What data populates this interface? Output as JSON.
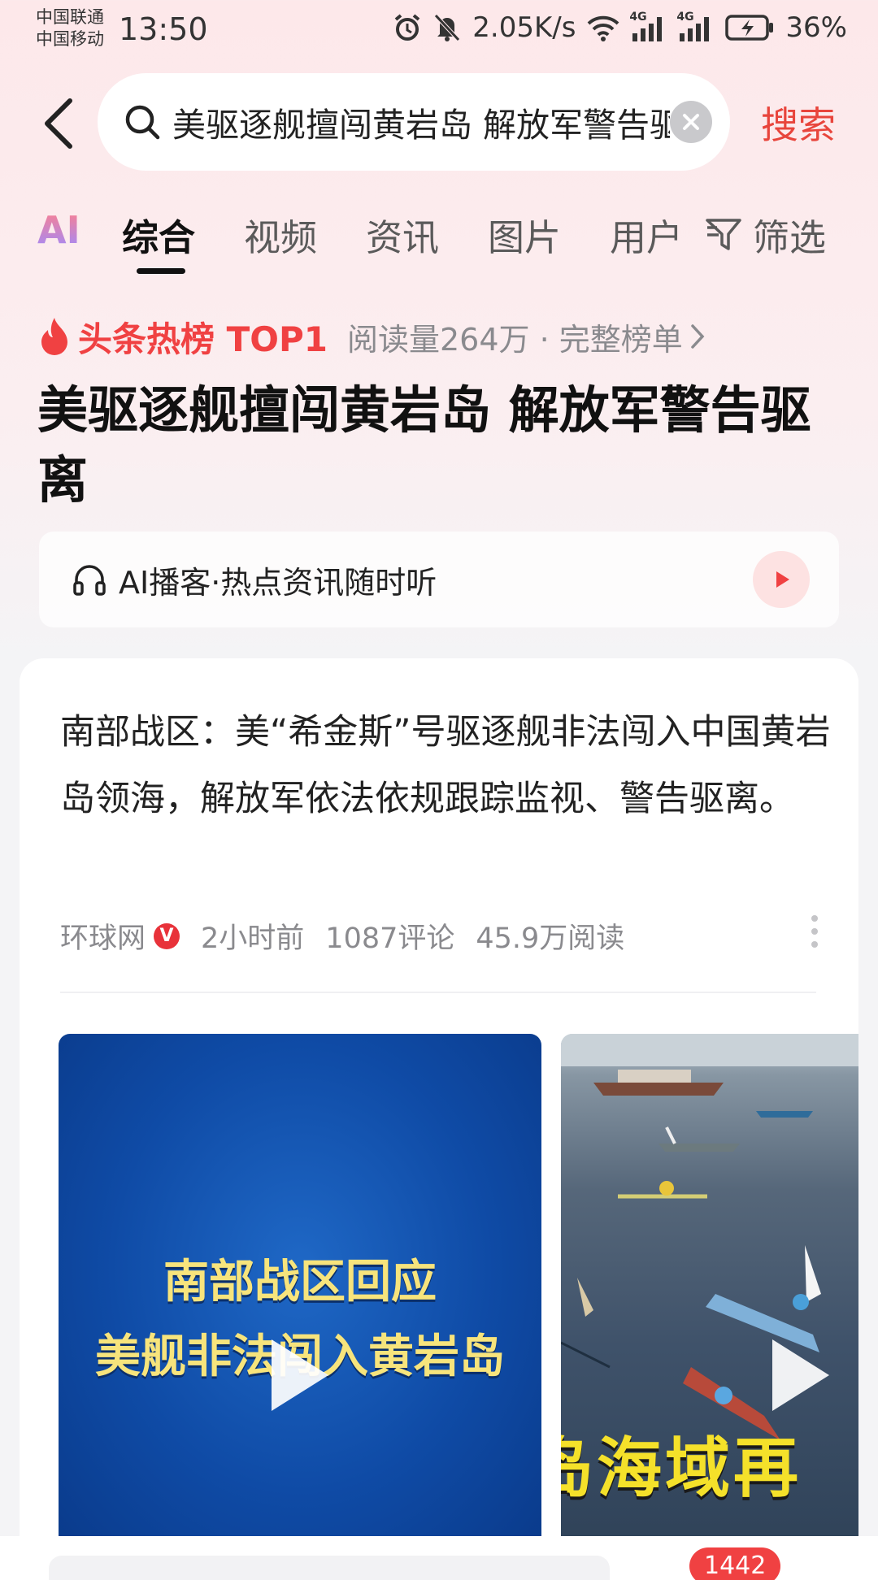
{
  "status_bar": {
    "carrier_1": "中国联通",
    "carrier_2": "中国移动",
    "time": "13:50",
    "network_speed": "2.05K/s",
    "net_type_1": "4G",
    "net_type_2": "4G",
    "battery": "36%"
  },
  "search": {
    "query": "美驱逐舰擅闯黄岩岛 解放军警告驱离",
    "submit_label": "搜索"
  },
  "tabs": {
    "ai_label": "AI",
    "items": [
      "综合",
      "视频",
      "资讯",
      "图片",
      "用户"
    ],
    "active_index": 0,
    "filter_label": "筛选"
  },
  "hot": {
    "label": "头条热榜 TOP1",
    "meta": "阅读量264万 · 完整榜单",
    "headline": "美驱逐舰擅闯黄岩岛 解放军警告驱离"
  },
  "podcast": {
    "label": "AI播客·热点资讯随时听"
  },
  "article": {
    "title": "南部战区：美“希金斯”号驱逐舰非法闯入中国黄岩岛领海，解放军依法依规跟踪监视、警告驱离。",
    "source": "环球网",
    "verified_mark": "V",
    "time": "2小时前",
    "comments": "1087评论",
    "reads": "45.9万阅读"
  },
  "videos": [
    {
      "caption_line1": "南部战区回应",
      "caption_line2": "美舰非法闯入黄岩岛"
    },
    {
      "caption": "岛海域再"
    }
  ],
  "bottom": {
    "comment_count": "1442"
  },
  "colors": {
    "accent": "#f04142",
    "search_submit": "#e8453c"
  }
}
